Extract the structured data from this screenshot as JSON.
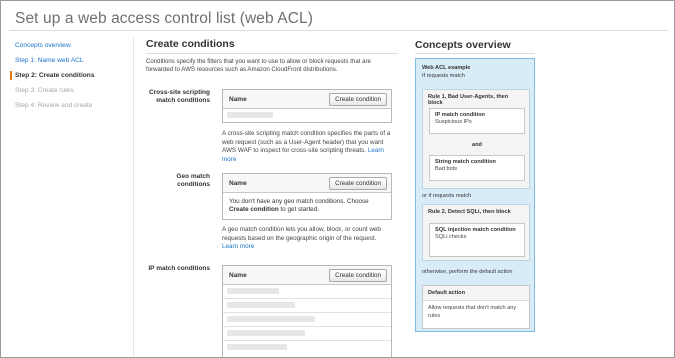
{
  "page": {
    "title": "Set up a web access control list (web ACL)"
  },
  "steps": [
    {
      "label": "Concepts overview",
      "state": "link"
    },
    {
      "label": "Step 1: Name web ACL",
      "state": "link"
    },
    {
      "label": "Step 2: Create conditions",
      "state": "current"
    },
    {
      "label": "Step 3: Create rules",
      "state": "disabled"
    },
    {
      "label": "Step 4: Review and create",
      "state": "disabled"
    }
  ],
  "main": {
    "heading": "Create conditions",
    "intro": "Conditions specify the filters that you want to use to allow or block requests that are forwarded to AWS resources such as Amazon CloudFront distributions.",
    "xss": {
      "label": "Cross-site scripting match conditions",
      "column": "Name",
      "button": "Create condition",
      "description": "A cross-site scripting match condition specifies the parts of a web request (such as a User-Agent header) that you want AWS WAF to inspect for cross-site scripting threats.",
      "learn_more": "Learn more"
    },
    "geo": {
      "label": "Geo match conditions",
      "column": "Name",
      "button": "Create condition",
      "empty_before": "You don't have any geo match conditions. Choose ",
      "empty_bold": "Create condition",
      "empty_after": " to get started.",
      "description": "A geo match condition lets you allow, block, or count web requests based on the geographic origin of the request.",
      "learn_more": "Learn more"
    },
    "ip": {
      "label": "IP match conditions",
      "column": "Name",
      "button": "Create condition"
    }
  },
  "concepts": {
    "heading": "Concepts overview",
    "example_title": "Web ACL example",
    "if_match": "If requests match",
    "rule1": {
      "title": "Rule 1, Bad User-Agents, then block",
      "cond1_title": "IP match condition",
      "cond1_sub": "Suspicious IPs",
      "and": "and",
      "cond2_title": "String match condition",
      "cond2_sub": "Bad bots"
    },
    "or_if": "or if requests match",
    "rule2": {
      "title": "Rule 2, Detect SQLi, then block",
      "cond_title": "SQL injection match condition",
      "cond_sub": "SQLi checks"
    },
    "otherwise": "otherwise, perform the default action",
    "default_title": "Default action",
    "default_text": "Allow requests that don't match any rules"
  },
  "colors": {
    "link": "#1a73c7",
    "accent": "#e47911",
    "concepts_bg": "#d8ecf8",
    "concepts_border": "#7fbde3"
  }
}
